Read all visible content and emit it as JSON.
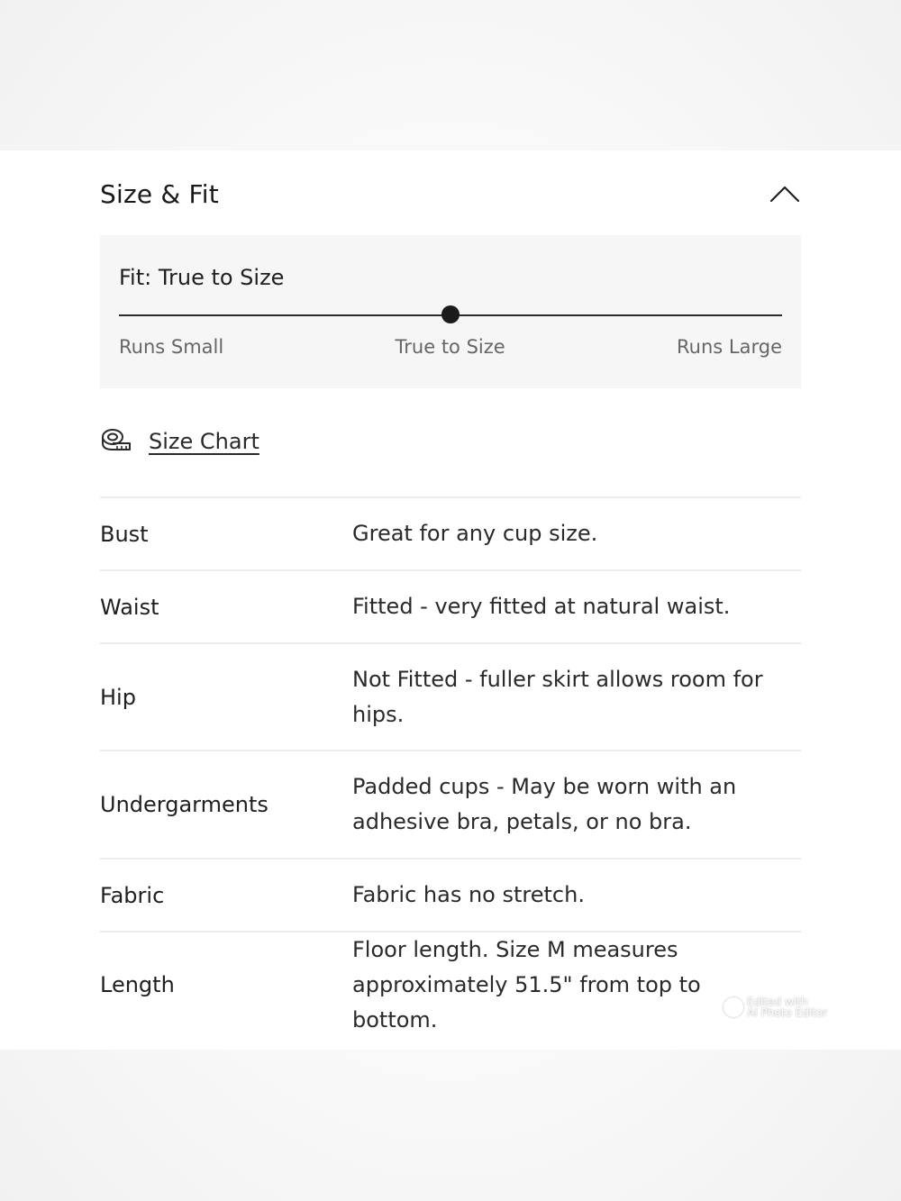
{
  "header": {
    "title": "Size & Fit",
    "toggle_icon": "chevron-up-icon"
  },
  "fit": {
    "title": "Fit: True to Size",
    "level": 0.5,
    "labels": {
      "small": "Runs Small",
      "true": "True to Size",
      "large": "Runs Large"
    }
  },
  "size_chart": {
    "icon": "measuring-tape-icon",
    "label": "Size Chart"
  },
  "specs": [
    {
      "name": "Bust",
      "value": "Great for any cup size."
    },
    {
      "name": "Waist",
      "value": "Fitted - very fitted at natural waist."
    },
    {
      "name": "Hip",
      "value": "Not Fitted - fuller skirt allows room for hips."
    },
    {
      "name": "Undergarments",
      "value": "Padded cups - May be worn with an adhesive bra, petals, or no bra."
    },
    {
      "name": "Fabric",
      "value": "Fabric has no stretch."
    },
    {
      "name": "Length",
      "value": "Floor length. Size M measures approximately 51.5\" from top to bottom."
    }
  ],
  "watermark": {
    "line1": "Edited with",
    "line2": "AI Photo Editor"
  }
}
